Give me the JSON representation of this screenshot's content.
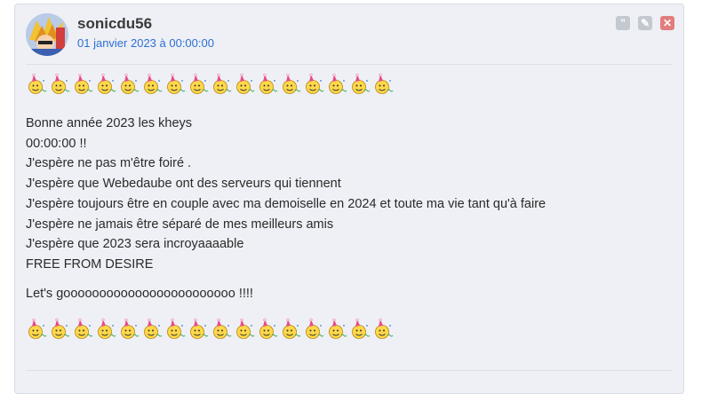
{
  "post": {
    "username": "sonicdu56",
    "date": "01 janvier 2023 à 00:00:00",
    "actions": [
      {
        "name": "quote-button",
        "glyph": "”"
      },
      {
        "name": "edit-button",
        "glyph": "✎"
      },
      {
        "name": "delete-button",
        "glyph": "✕"
      }
    ],
    "smiley_count_top": 16,
    "smiley_count_bottom": 16,
    "smiley_icon": "party-hat-smiley-icon",
    "lines": [
      "Bonne année 2023 les kheys",
      "00:00:00 !!",
      "J'espère ne pas m'être foiré .",
      "J'espère que Webedaube ont des serveurs qui tiennent",
      "J'espère toujours être en couple avec ma demoiselle en 2024 et toute ma vie tant qu'à faire",
      "J'espère ne jamais être séparé de mes meilleurs amis",
      "J'espère que 2023 sera incroyaaaable",
      "FREE FROM DESIRE"
    ],
    "closing": "Let's goooooooooooooooooooooooo !!!!"
  },
  "colors": {
    "card_background": "#eef0f5",
    "date_link": "#2d6fd6",
    "delete_button": "#e27d7d"
  }
}
